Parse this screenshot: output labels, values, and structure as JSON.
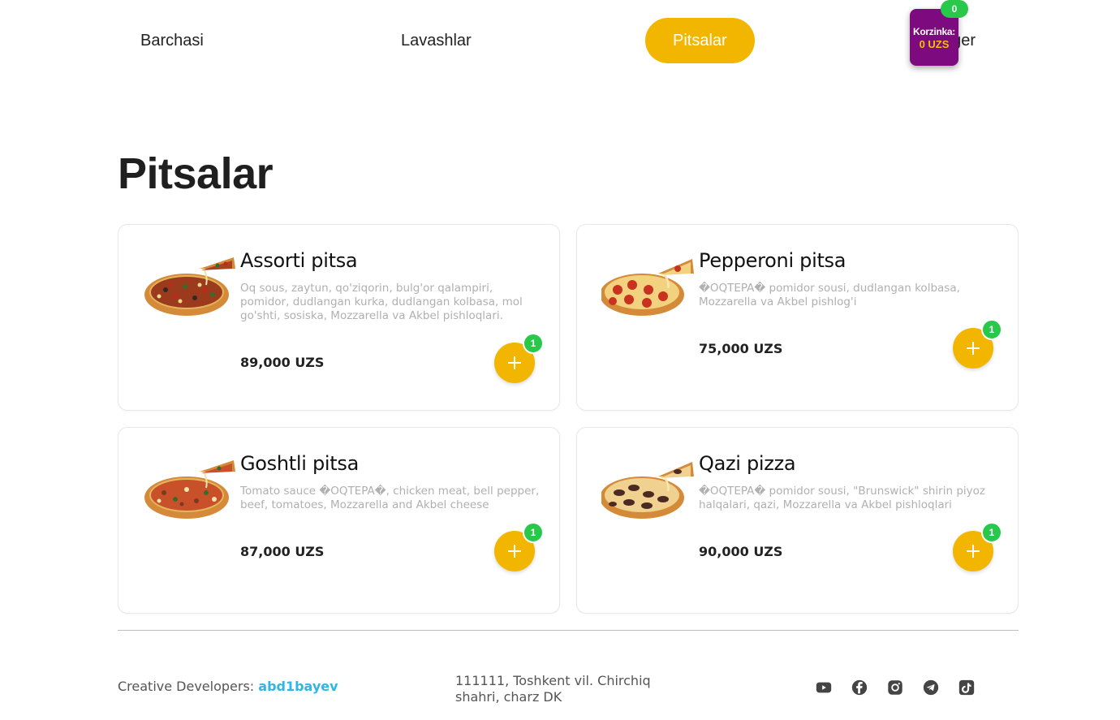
{
  "nav": {
    "items": [
      {
        "label": "Barchasi",
        "active": false
      },
      {
        "label": "Lavashlar",
        "active": false
      },
      {
        "label": "Pitsalar",
        "active": true
      },
      {
        "label": "Burger",
        "active": false
      }
    ]
  },
  "cart": {
    "label": "Korzinka:",
    "total": "0 UZS",
    "count": "0",
    "color": "#7d0a7e"
  },
  "section": {
    "title": "Pitsalar"
  },
  "products": [
    {
      "name": "Assorti pitsa",
      "description": "Oq sous, zaytun, qo'ziqorin, bulg'or qalampiri, pomidor, dudlangan kurka, dudlangan kolbasa, mol go'shti, sosiska, Mozzarella va Akbel pishloqlari.",
      "price": "89,000 UZS",
      "qty": "1",
      "image": "pizza-assorti-image"
    },
    {
      "name": "Pepperoni pitsa",
      "description": "�OQTEPA� pomidor sousi, dudlangan kolbasa, Mozzarella va Akbel pishlog'i",
      "price": "75,000 UZS",
      "qty": "1",
      "image": "pizza-pepperoni-image"
    },
    {
      "name": "Goshtli pitsa",
      "description": "Tomato sauce �OQTEPA�, chicken meat, bell pepper, beef, tomatoes, Mozzarella and Akbel cheese",
      "price": "87,000 UZS",
      "qty": "1",
      "image": "pizza-goshtli-image"
    },
    {
      "name": "Qazi pizza",
      "description": "�OQTEPA� pomidor sousi, \"Brunswick\" shirin piyoz halqalari, qazi, Mozzarella va Akbel pishloqlari",
      "price": "90,000 UZS",
      "qty": "1",
      "image": "pizza-qazi-image"
    }
  ],
  "footer": {
    "credit_label": "Creative Developers: ",
    "developer": "abd1bayev",
    "address": "111111, Toshkent vil. Chirchiq shahri, charz DK",
    "social_icons": [
      "youtube-icon",
      "facebook-icon",
      "instagram-icon",
      "telegram-icon",
      "tiktok-icon"
    ]
  },
  "colors": {
    "accent": "#f2b600",
    "badge": "#28c84a",
    "cart": "#7d0a7e",
    "developer_link": "#2fb6e8"
  }
}
